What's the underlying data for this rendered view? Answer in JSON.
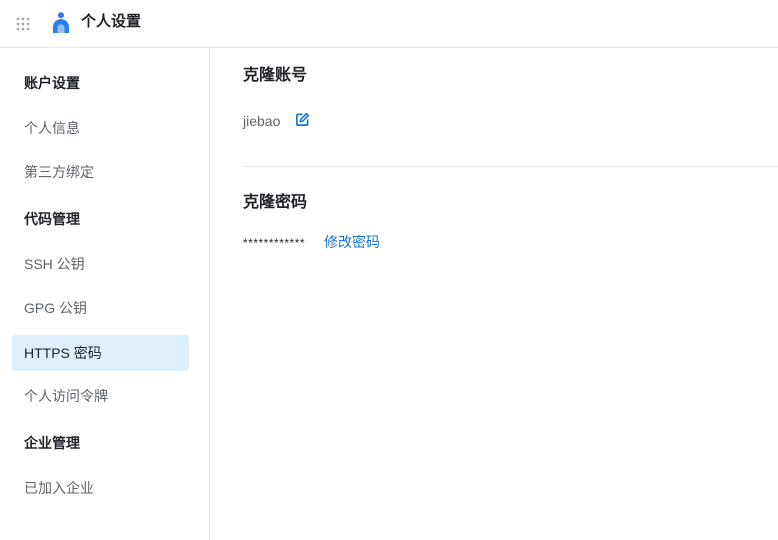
{
  "header": {
    "title": "个人设置"
  },
  "sidebar": {
    "sections": [
      {
        "label": "账户设置"
      },
      {
        "label": "代码管理"
      },
      {
        "label": "企业管理"
      }
    ],
    "items": [
      {
        "label": "个人信息"
      },
      {
        "label": "第三方绑定"
      },
      {
        "label": "SSH 公钥"
      },
      {
        "label": "GPG 公钥"
      },
      {
        "label": "HTTPS 密码",
        "active": true
      },
      {
        "label": "个人访问令牌"
      },
      {
        "label": "已加入企业"
      }
    ]
  },
  "main": {
    "clone_account": {
      "title": "克隆账号",
      "username": "jiebao"
    },
    "clone_password": {
      "title": "克隆密码",
      "masked_value": "************",
      "change_link": "修改密码"
    }
  },
  "colors": {
    "accent": "#1874d1",
    "active_bg": "#deeffd",
    "logo": "#2b7de9"
  },
  "icons": {
    "menu": "apps-grid-icon",
    "logo": "person-logo-icon",
    "edit": "edit-icon"
  }
}
